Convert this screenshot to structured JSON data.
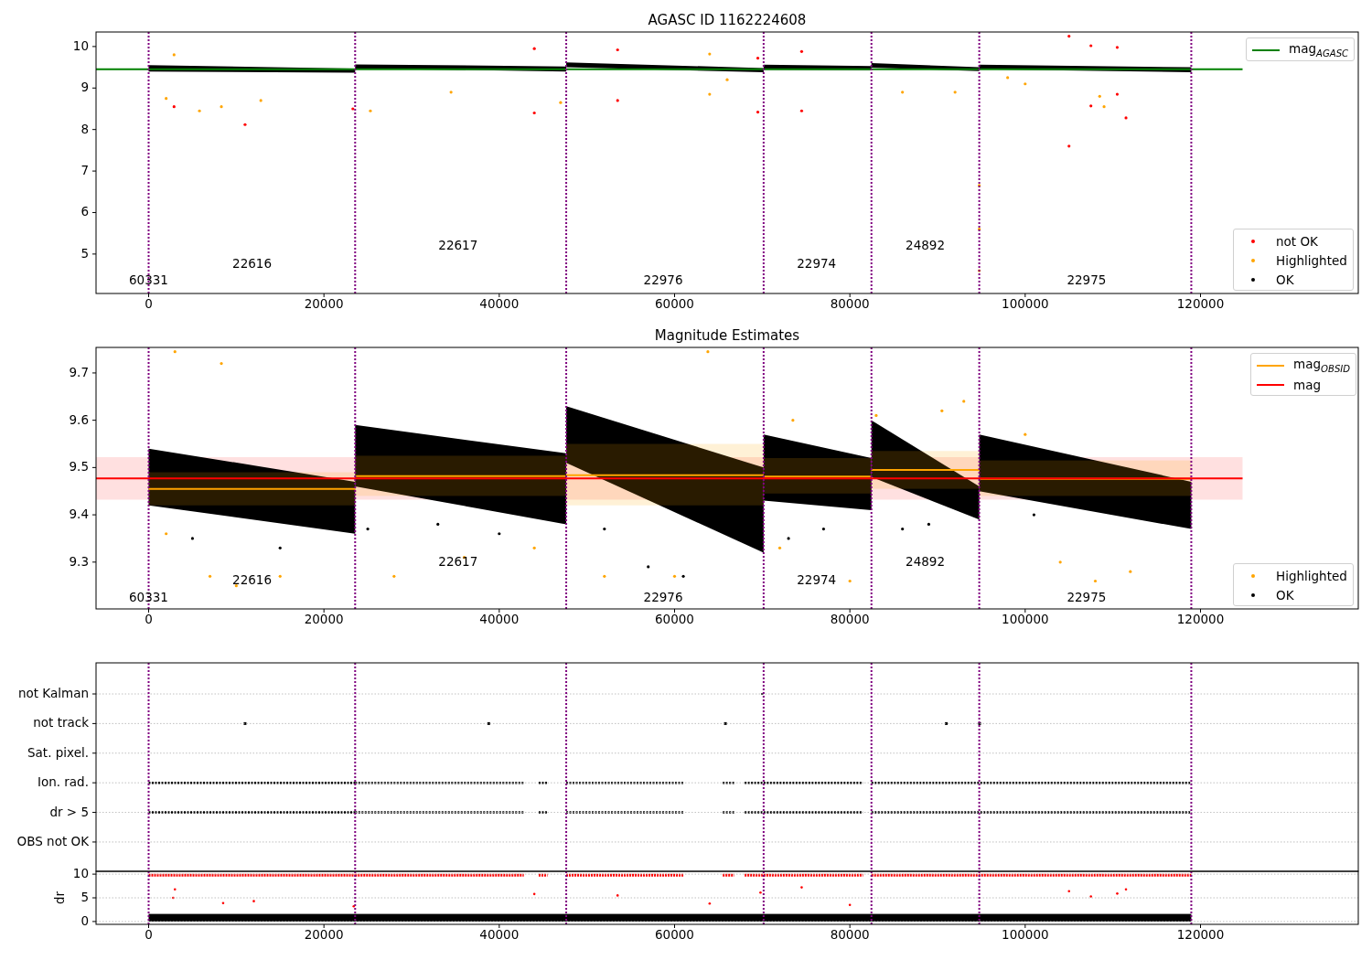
{
  "figure": {
    "panels": [
      {
        "kind": "overview",
        "charts": [
          {
            "chart_data": {
              "type": "line",
              "title": "AGASC ID 1162224608",
              "x": [
                -6000,
                124800
              ],
              "series": [
                {
                  "name": "mag$_{AGASC}$",
                  "color": "#008000",
                  "values": [
                    9.45,
                    9.45
                  ]
                }
              ],
              "xlim": [
                -6000,
                138000
              ],
              "ylim": [
                4.05,
                10.35
              ],
              "xticks": [
                0,
                20000,
                40000,
                60000,
                80000,
                100000,
                120000
              ],
              "yticks": [
                5,
                6,
                7,
                8,
                9,
                10
              ],
              "ref_lines": [
                {
                  "axis": "x",
                  "value": 0
                },
                {
                  "axis": "x",
                  "value": 23560
                },
                {
                  "axis": "x",
                  "value": 47640
                },
                {
                  "axis": "x",
                  "value": 70160
                },
                {
                  "axis": "x",
                  "value": 82460
                },
                {
                  "axis": "x",
                  "value": 94760
                },
                {
                  "axis": "x",
                  "value": 118950
                }
              ],
              "annotations": [
                "60331",
                "22616",
                "22617",
                "22976",
                "22974",
                "24892",
                "22975"
              ]
            }
          }
        ],
        "markers": [
          {
            "label": "not OK",
            "color": "#ff0000"
          },
          {
            "label": "Highlighted",
            "color": "#ffa500"
          },
          {
            "label": "OK",
            "color": "#000000"
          }
        ]
      },
      {
        "kind": "estimates",
        "charts": [
          {
            "chart_data": {
              "type": "line",
              "title": "Magnitude Estimates",
              "x": [
                -6000,
                0,
                23560,
                23560,
                47640,
                47640,
                70160,
                70160,
                82460,
                82460,
                94760,
                94760,
                118950,
                124800
              ],
              "series": [
                {
                  "name": "mag$_{OBSID}$",
                  "color": "#ffa500",
                  "values": [
                    null,
                    9.455,
                    9.455,
                    9.482,
                    9.482,
                    9.484,
                    9.484,
                    9.481,
                    9.481,
                    9.495,
                    9.495,
                    9.476,
                    9.476,
                    null
                  ]
                },
                {
                  "name": "mag",
                  "color": "#ff0000",
                  "values": [
                    9.477,
                    9.477,
                    9.477,
                    9.477,
                    9.477,
                    9.477,
                    9.477,
                    9.477,
                    9.477,
                    9.477,
                    9.477,
                    9.477,
                    9.477,
                    9.477
                  ]
                }
              ],
              "xlim": [
                -6000,
                138000
              ],
              "ylim": [
                9.201,
                9.754
              ],
              "xticks": [
                0,
                20000,
                40000,
                60000,
                80000,
                100000,
                120000
              ],
              "yticks": [
                9.3,
                9.4,
                9.5,
                9.6,
                9.7
              ],
              "ref_lines": [
                {
                  "axis": "x",
                  "value": 0
                },
                {
                  "axis": "x",
                  "value": 23560
                },
                {
                  "axis": "x",
                  "value": 47640
                },
                {
                  "axis": "x",
                  "value": 70160
                },
                {
                  "axis": "x",
                  "value": 82460
                },
                {
                  "axis": "x",
                  "value": 94760
                },
                {
                  "axis": "x",
                  "value": 118950
                }
              ],
              "annotations": [
                "60331",
                "22616",
                "22617",
                "22976",
                "22974",
                "24892",
                "22975"
              ]
            }
          }
        ],
        "markers": [
          {
            "label": "Highlighted",
            "color": "#ffa500"
          },
          {
            "label": "OK",
            "color": "#000000"
          }
        ]
      },
      {
        "kind": "flags",
        "charts": [
          {
            "chart_data": {
              "type": "scatter",
              "orientation": "horizontal",
              "grid": true,
              "categories": [
                "not Kalman",
                "not track",
                "Sat. pixel.",
                "Ion. rad.",
                "dr > 5",
                "OBS not OK"
              ],
              "xlim": [
                -6000,
                138000
              ],
              "ref_lines": [
                {
                  "axis": "x",
                  "value": 0
                },
                {
                  "axis": "x",
                  "value": 23560
                },
                {
                  "axis": "x",
                  "value": 47640
                },
                {
                  "axis": "x",
                  "value": 70160
                },
                {
                  "axis": "x",
                  "value": 82460
                },
                {
                  "axis": "x",
                  "value": 94760
                },
                {
                  "axis": "x",
                  "value": 118950
                }
              ]
            }
          },
          {
            "chart_data": {
              "type": "scatter",
              "ylabel": "dr",
              "grid": true,
              "xlim": [
                -6000,
                138000
              ],
              "ylim": [
                -0.6,
                10.6
              ],
              "xticks": [
                0,
                20000,
                40000,
                60000,
                80000,
                100000,
                120000
              ],
              "yticks": [
                0,
                5,
                10
              ],
              "ref_lines": [
                {
                  "axis": "x",
                  "value": 0
                },
                {
                  "axis": "x",
                  "value": 23560
                },
                {
                  "axis": "x",
                  "value": 47640
                },
                {
                  "axis": "x",
                  "value": 70160
                },
                {
                  "axis": "x",
                  "value": 82460
                },
                {
                  "axis": "x",
                  "value": 94760
                },
                {
                  "axis": "x",
                  "value": 118950
                }
              ]
            }
          }
        ]
      }
    ]
  }
}
